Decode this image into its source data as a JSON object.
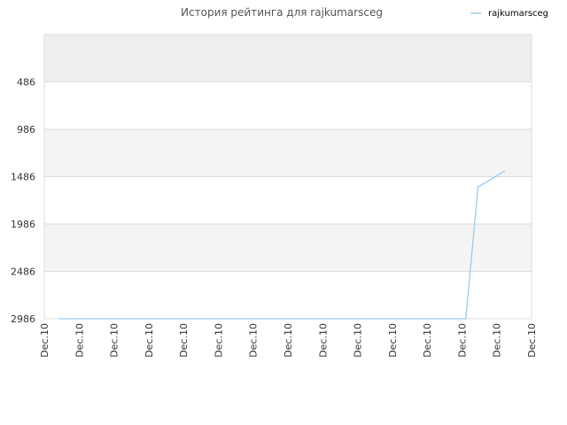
{
  "chart_data": {
    "type": "line",
    "title": "История рейтинга для rajkumarsceg",
    "xlabel": "",
    "ylabel": "",
    "y_reversed": true,
    "ylim": [
      -14,
      2986
    ],
    "y_ticks": [
      486,
      986,
      1486,
      1986,
      2486,
      2986
    ],
    "grid": true,
    "legend": "top-right",
    "x_tick_labels": [
      "Dec.10",
      "Dec.10",
      "Dec.10",
      "Dec.10",
      "Dec.10",
      "Dec.10",
      "Dec.10",
      "Dec.10",
      "Dec.10",
      "Dec.10",
      "Dec.10",
      "Dec.10",
      "Dec.10",
      "Dec.10",
      "Dec.10"
    ],
    "series": [
      {
        "name": "rajkumarsceg",
        "color": "#9ccbea",
        "x": [
          0.03,
          0.865,
          0.89,
          0.945
        ],
        "y": [
          2986,
          2986,
          1596,
          1426
        ]
      }
    ]
  },
  "colors": {
    "band_even": "#eeeeee",
    "band_odd": "#f4f4f4",
    "plot_bg": "#ffffff",
    "grid": "#dddddd"
  }
}
